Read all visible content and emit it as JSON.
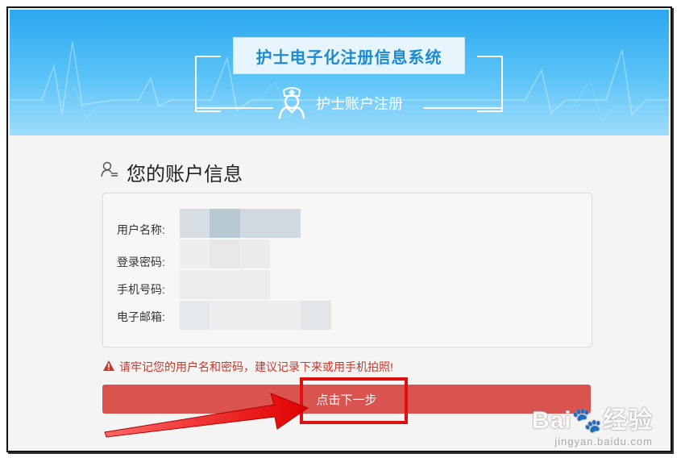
{
  "header": {
    "title": "护士电子化注册信息系统",
    "subtitle": "护士账户注册"
  },
  "section": {
    "title": "您的账户信息"
  },
  "account_info": {
    "fields": [
      {
        "label": "用户名称:"
      },
      {
        "label": "登录密码:"
      },
      {
        "label": "手机号码:"
      },
      {
        "label": "电子邮箱:"
      }
    ]
  },
  "warning": {
    "text": "请牢记您的用户名和密码，建议记录下来或用手机拍照!",
    "icon": "warning-triangle-icon"
  },
  "actions": {
    "next_label": "点击下一步"
  },
  "watermark": {
    "brand": "Bai",
    "brand2": "经验",
    "url": "jingyan.baidu.com"
  },
  "colors": {
    "banner": "#2aa8f0",
    "title_text": "#1c8bd1",
    "button": "#d9534f",
    "warning": "#c0392b",
    "highlight": "#e01010"
  }
}
